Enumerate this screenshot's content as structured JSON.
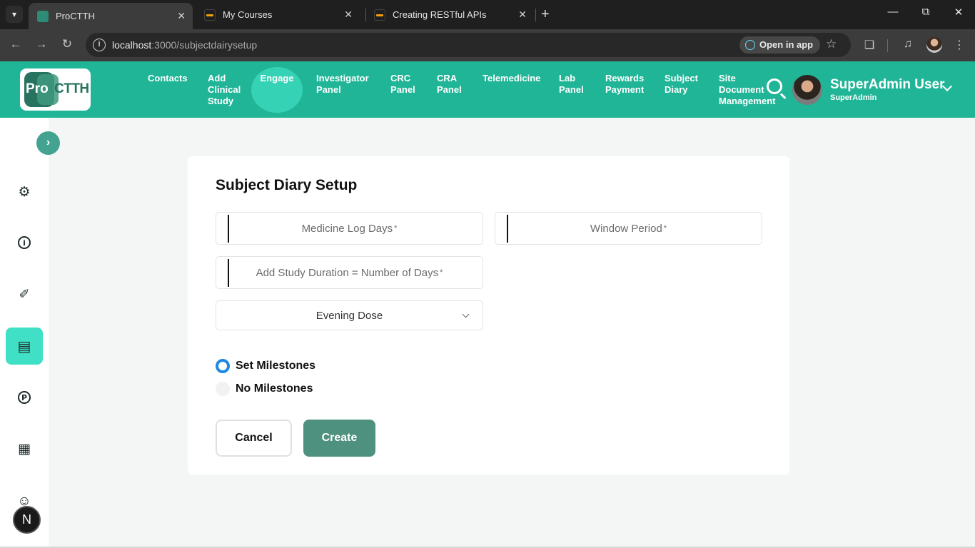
{
  "browser": {
    "tabs": [
      {
        "title": "ProCTTH",
        "active": true
      },
      {
        "title": "My Courses",
        "active": false
      },
      {
        "title": "Creating RESTful APIs",
        "active": false
      }
    ],
    "url_host": "localhost",
    "url_path": ":3000/subjectdairysetup",
    "open_in_app": "Open in app"
  },
  "header": {
    "logo_pro": "Pro",
    "logo_ctth": "CTTH",
    "nav": [
      {
        "label": "Contacts"
      },
      {
        "label": "Add\nClinical\nStudy"
      },
      {
        "label": "Engage"
      },
      {
        "label": "Investigator\nPanel"
      },
      {
        "label": "CRC\nPanel"
      },
      {
        "label": "CRA\nPanel"
      },
      {
        "label": "Telemedicine"
      },
      {
        "label": "Lab\nPanel"
      },
      {
        "label": "Rewards\nPayment"
      },
      {
        "label": "Subject\nDiary"
      },
      {
        "label": "Site\nDocument\nManagement"
      }
    ],
    "user_name": "SuperAdmin User",
    "user_role": "SuperAdmin"
  },
  "sidebar": {
    "badge": "N"
  },
  "form": {
    "title": "Subject Diary Setup",
    "medicine_log_days": "Medicine Log Days",
    "window_period": "Window Period",
    "study_duration": "Add Study Duration = Number of Days",
    "required_mark": "*",
    "dose_select": "Evening Dose",
    "radio_set": "Set Milestones",
    "radio_none": "No Milestones",
    "cancel": "Cancel",
    "create": "Create"
  }
}
